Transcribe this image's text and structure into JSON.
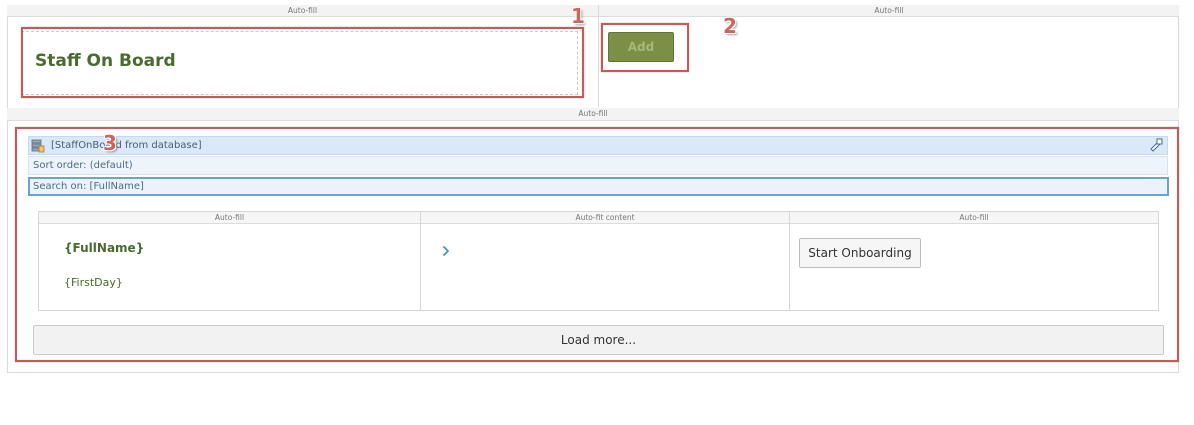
{
  "layout_labels": {
    "autofill": "Auto-fill",
    "autofit": "Auto-fit content"
  },
  "header": {
    "title": "Staff On Board",
    "add_button_label": "Add"
  },
  "repeater": {
    "source_label": "[StaffOnBoard from database]",
    "sort_order": "Sort order: (default)",
    "search_on": "Search on: [FullName]",
    "item": {
      "fullname": "{FullName}",
      "firstday": "{FirstDay}",
      "action_button": "Start Onboarding"
    },
    "load_more": "Load more..."
  },
  "annotations": [
    "1",
    "2",
    "3"
  ],
  "colors": {
    "title_green": "#4a6a30",
    "add_button_bg": "#7b8f47",
    "annotation_red": "#c55a5a",
    "header_blue": "#dbe8f7",
    "search_border": "#6aa2d2"
  },
  "icons": {
    "database": "database-icon",
    "edit": "edit-icon",
    "chevron": "chevron-right-icon"
  }
}
